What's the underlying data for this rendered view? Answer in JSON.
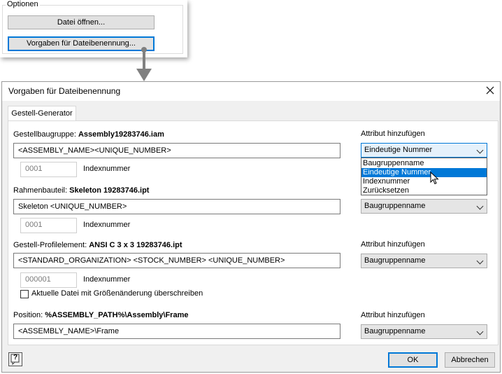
{
  "options_panel": {
    "title": "Optionen",
    "open_file_label": "Datei öffnen...",
    "naming_defaults_label": "Vorgaben für Dateibenennung..."
  },
  "dialog": {
    "title": "Vorgaben für Dateibenennung",
    "tab_label": "Gestell-Generator",
    "sections": [
      {
        "label_prefix": "Gestellbaugruppe:",
        "label_value": "Assembly19283746.iam",
        "pattern": "<ASSEMBLY_NAME><UNIQUE_NUMBER>",
        "attr_title": "Attribut hinzufügen",
        "combo_value": "Eindeutige Nummer",
        "index_value": "0001",
        "index_label": "Indexnummer"
      },
      {
        "label_prefix": "Rahmenbauteil:",
        "label_value": "Skeleton 19283746.ipt",
        "pattern": "Skeleton <UNIQUE_NUMBER>",
        "combo_value": "Baugruppenname",
        "index_value": "0001",
        "index_label": "Indexnummer"
      },
      {
        "label_prefix": "Gestell-Profilelement:",
        "label_value": "ANSI C 3 x 3 19283746.ipt",
        "pattern": "<STANDARD_ORGANIZATION> <STOCK_NUMBER> <UNIQUE_NUMBER>",
        "attr_title": "Attribut hinzufügen",
        "combo_value": "Baugruppenname",
        "index_value": "000001",
        "index_label": "Indexnummer"
      },
      {
        "label_prefix": "Position:",
        "label_value": "%ASSEMBLY_PATH%\\Assembly\\Frame",
        "pattern": "<ASSEMBLY_NAME>\\Frame",
        "attr_title": "Attribut hinzufügen",
        "combo_value": "Baugruppenname"
      }
    ],
    "overwrite_checkbox_label": "Aktuelle Datei mit Größenänderung überschreiben",
    "overwrite_checked": false,
    "dropdown_options": [
      "Baugruppenname",
      "Eindeutige Nummer",
      "Indexnummer",
      "Zurücksetzen"
    ],
    "dropdown_highlighted": "Eindeutige Nummer",
    "help_icon_text": "?",
    "ok_label": "OK",
    "cancel_label": "Abbrechen"
  },
  "colors": {
    "accent": "#0078d7",
    "arrow": "#808080"
  }
}
